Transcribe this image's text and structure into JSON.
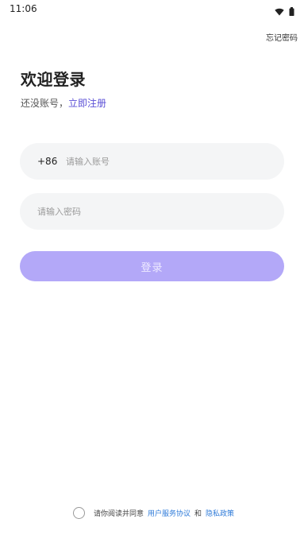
{
  "status_bar": {
    "time": "11:06"
  },
  "header": {
    "forgot_password": "忘记密码"
  },
  "main": {
    "title": "欢迎登录",
    "no_account_text": "还没账号，",
    "register_link": "立即注册",
    "account_field": {
      "country_code": "+86",
      "placeholder": "请输入账号",
      "value": ""
    },
    "password_field": {
      "placeholder": "请输入密码",
      "value": ""
    },
    "login_button": "登录"
  },
  "footer": {
    "agreement_prefix": "请你阅读并同意",
    "user_agreement": "用户服务协议",
    "conjunction": "和",
    "privacy_policy": "隐私政策",
    "agreed": false
  },
  "colors": {
    "accent": "#b3a8f8",
    "link_purple": "#5a4fd6",
    "link_blue": "#2f7bd9",
    "field_bg": "#f4f5f6"
  }
}
